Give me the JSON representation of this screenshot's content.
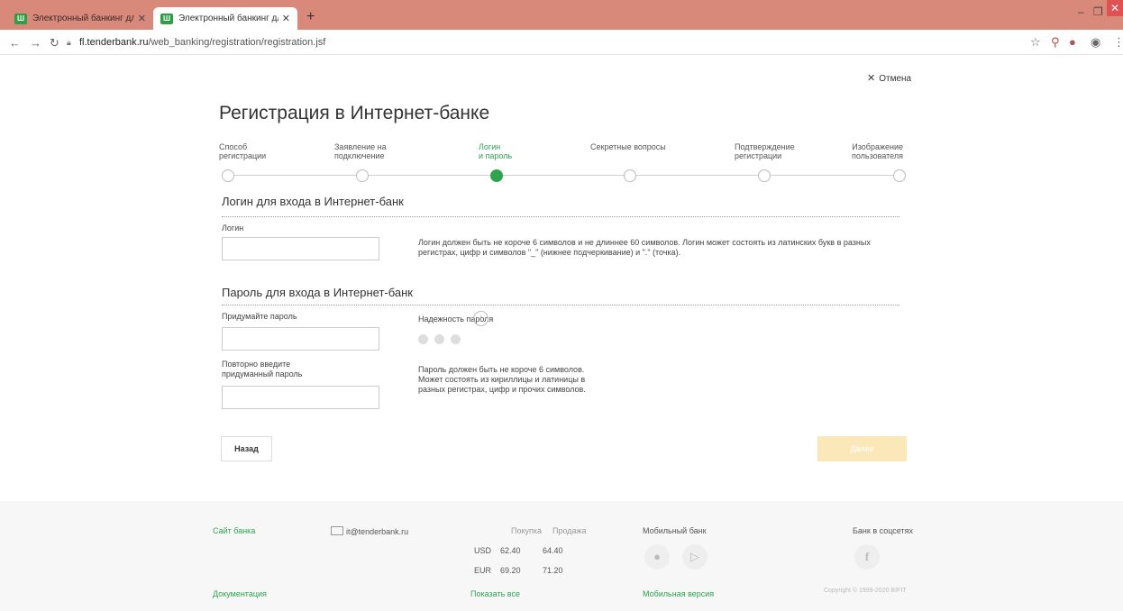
{
  "browser": {
    "tabs": [
      {
        "title": "Электронный банкинг для частн"
      },
      {
        "title": "Электронный банкинг для частн"
      }
    ],
    "url_domain": "fl.tenderbank.ru",
    "url_path": "/web_banking/registration/registration.jsf"
  },
  "page": {
    "cancel_label": "Отмена",
    "title": "Регистрация в Интернет-банке",
    "steps": [
      {
        "line1": "Способ",
        "line2": "регистрации"
      },
      {
        "line1": "Заявление на",
        "line2": "подключение"
      },
      {
        "line1": "Логин",
        "line2": "и пароль"
      },
      {
        "line1": "Секретные вопросы",
        "line2": ""
      },
      {
        "line1": "Подтверждение",
        "line2": "регистрации"
      },
      {
        "line1": "Изображение",
        "line2": "пользователя"
      }
    ],
    "active_step": 3,
    "login_section": {
      "title": "Логин для входа в Интернет-банк",
      "login_label": "Логин",
      "login_value": "",
      "hint_line1": "Логин должен быть не короче 6 символов и не длиннее 60 символов. Логин может состоять из латинских букв в разных",
      "hint_line2": "регистрах, цифр и символов \"_\" (нижнее подчеркивание) и \".\" (точка)."
    },
    "password_section": {
      "title": "Пароль для входа в Интернет-банк",
      "password_label": "Придумайте пароль",
      "password_value": "",
      "repeat_label_line1": "Повторно введите",
      "repeat_label_line2": "придуманный пароль",
      "repeat_value": "",
      "strength_label": "Надежность пароля",
      "strength_level": 0,
      "hint_line1": "Пароль должен быть не короче 6 символов.",
      "hint_line2": "Может состоять из кириллицы и латиницы в",
      "hint_line3": "разных регистрах, цифр и прочих символов."
    },
    "buttons": {
      "back": "Назад",
      "next": "Далее"
    }
  },
  "footer": {
    "bank_site": "Сайт банка",
    "documentation": "Документация",
    "email": "it@tenderbank.ru",
    "rates": {
      "buy_header": "Покупка",
      "sell_header": "Продажа",
      "rows": [
        {
          "currency": "USD",
          "buy": "62.40",
          "sell": "64.40"
        },
        {
          "currency": "EUR",
          "buy": "69.20",
          "sell": "71.20"
        }
      ],
      "show_all": "Показать все"
    },
    "mobile_bank": "Мобильный банк",
    "mobile_version": "Мобильная версия",
    "social": "Банк в соцсетях",
    "copyright": "Copyright © 1999-2020 BIFIT"
  },
  "colors": {
    "accent": "#2ea44f",
    "titlebar": "#d8897a",
    "next_button": "#fbe8b8"
  }
}
